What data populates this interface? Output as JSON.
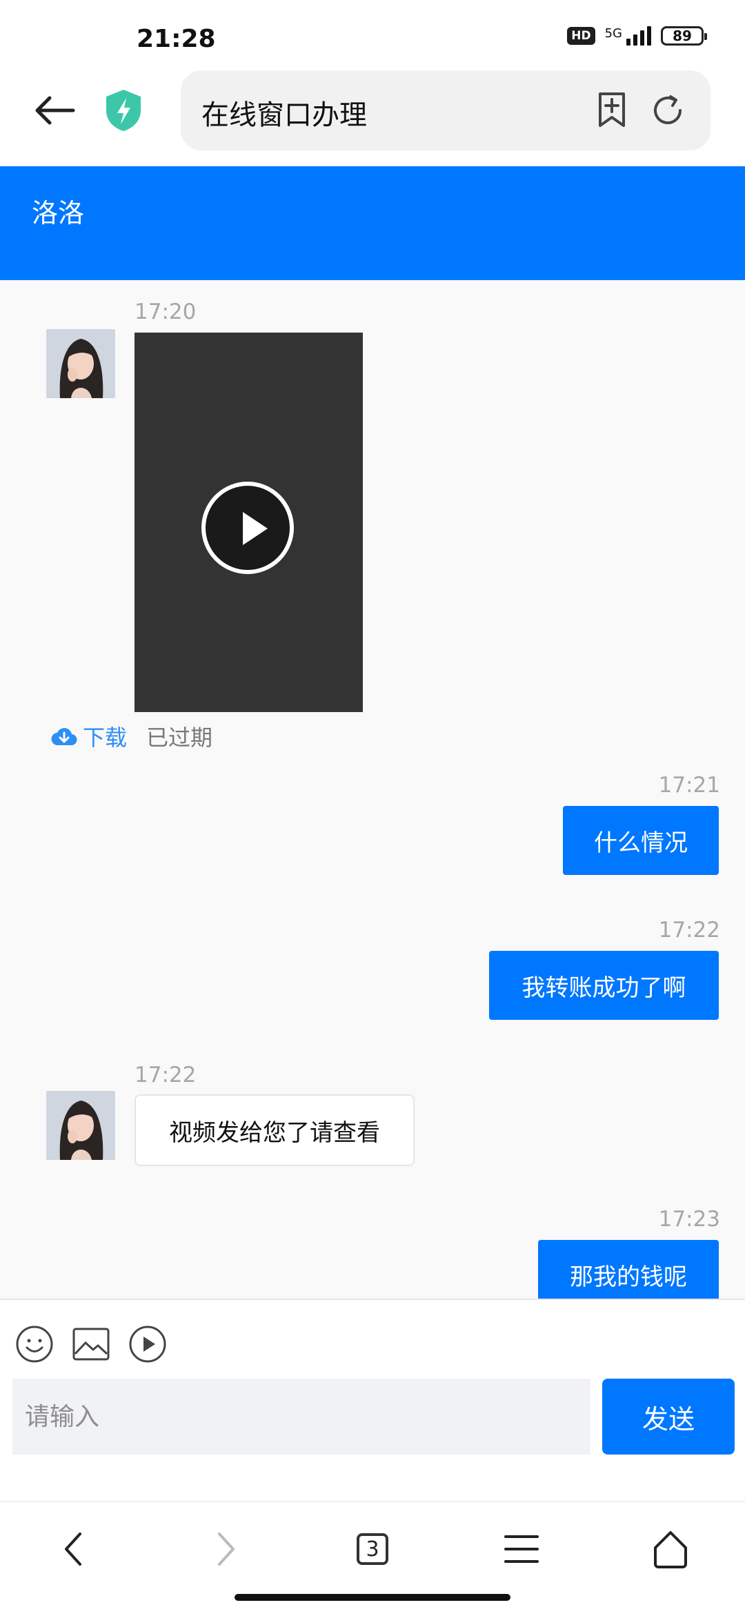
{
  "status_bar": {
    "time": "21:28",
    "hd": "HD",
    "network": "5G",
    "battery": "89"
  },
  "browser": {
    "url_title": "在线窗口办理",
    "tab_count": "3"
  },
  "chat": {
    "title": "洛洛",
    "messages": [
      {
        "time": "17:20",
        "type": "video",
        "download_label": "下载",
        "status": "已过期"
      },
      {
        "time": "17:21",
        "type": "text",
        "direction": "outgoing",
        "text": "什么情况"
      },
      {
        "time": "17:22",
        "type": "text",
        "direction": "outgoing",
        "text": "我转账成功了啊"
      },
      {
        "time": "17:22",
        "type": "text",
        "direction": "incoming",
        "text": "视频发给您了请查看"
      },
      {
        "time": "17:23",
        "type": "text",
        "direction": "outgoing",
        "text": "那我的钱呢"
      }
    ]
  },
  "composer": {
    "placeholder": "请输入",
    "send_label": "发送"
  },
  "colors": {
    "accent": "#0077ff",
    "video_bg": "#333333",
    "link": "#2e8ef5"
  }
}
